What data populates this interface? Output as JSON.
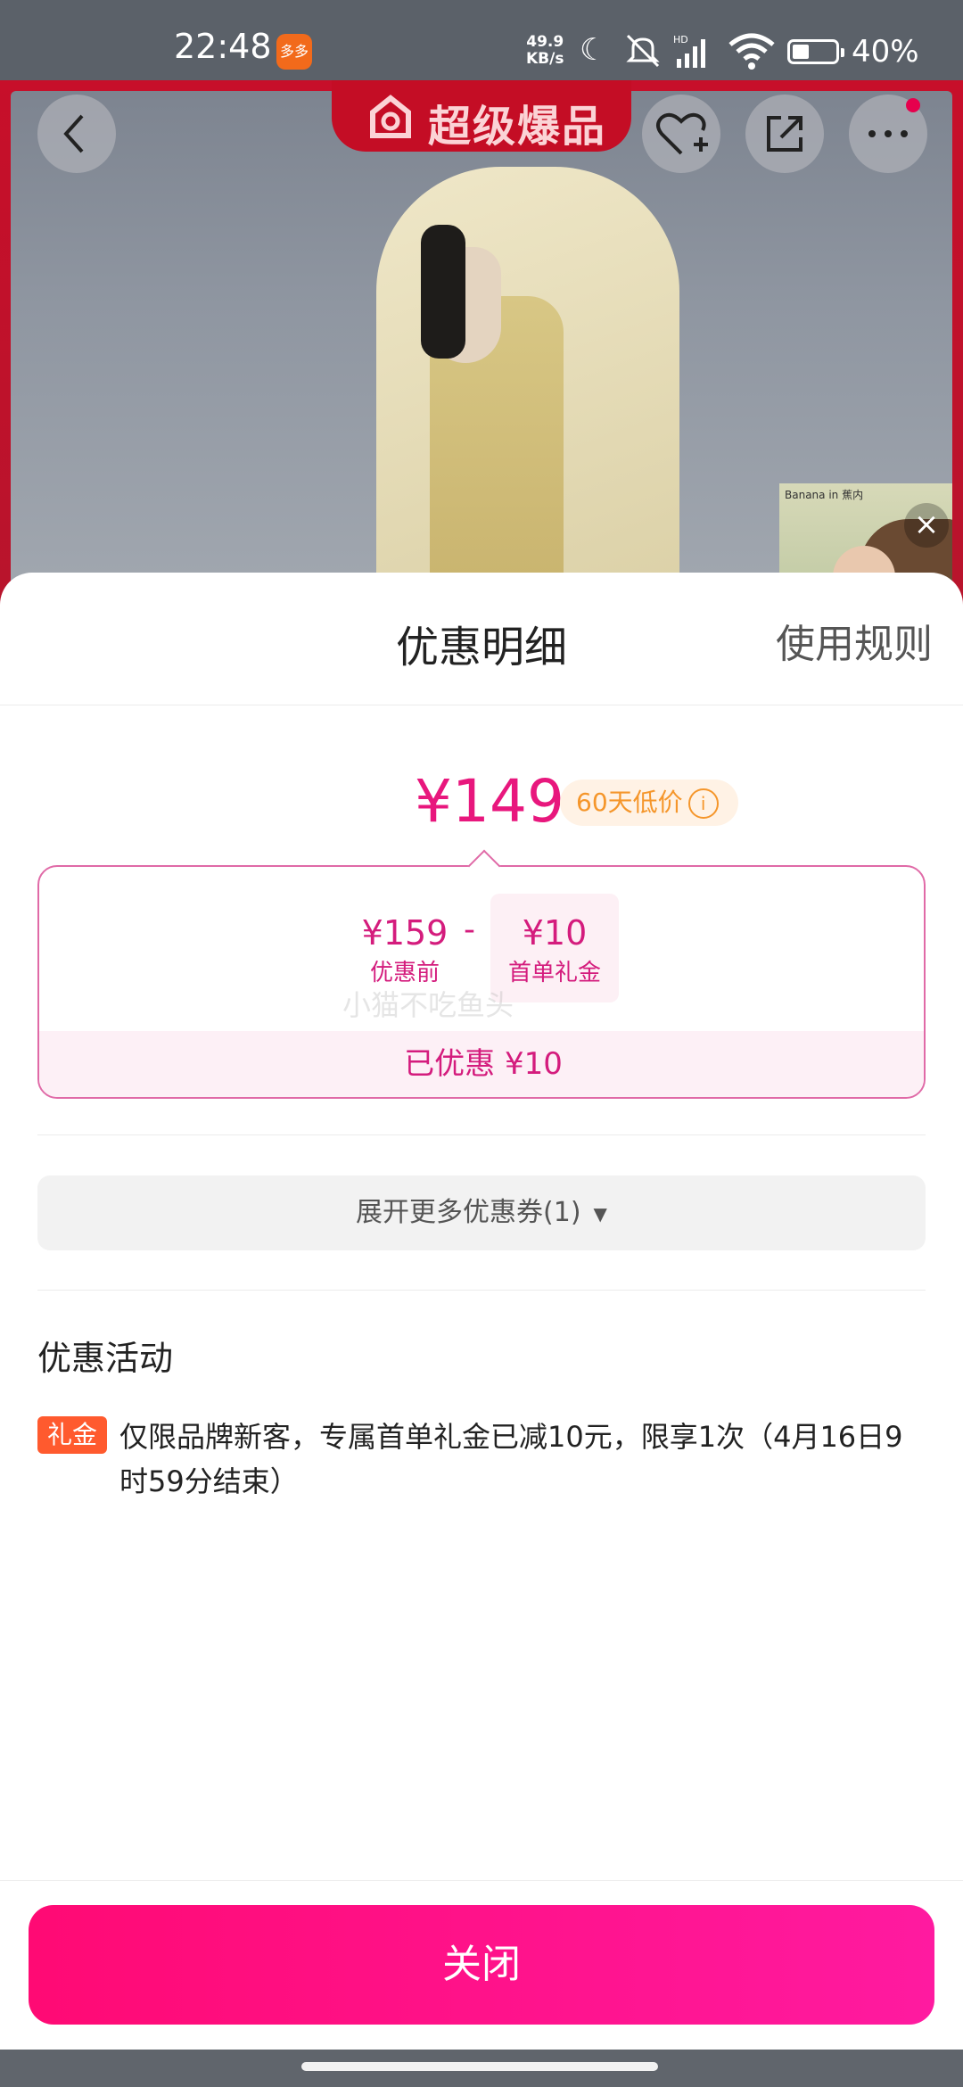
{
  "status_bar": {
    "time": "22:48",
    "app_icon_label": "多多",
    "net_speed_value": "49.9",
    "net_speed_unit": "KB/s",
    "battery_text": "40%"
  },
  "hero": {
    "brand_label": "超级爆品",
    "mini_video_label": "Banana in 蕉内"
  },
  "sheet": {
    "title": "优惠明细",
    "rules_link": "使用规则",
    "final_price": "¥149",
    "low_price_badge": "60天低价",
    "breakdown": {
      "original_amount": "¥159",
      "original_label": "优惠前",
      "minus_sign": "-",
      "gift_amount": "¥10",
      "gift_label": "首单礼金",
      "saved_text": "已优惠 ¥10"
    },
    "watermark": "小猫不吃鱼头",
    "expand_button": "展开更多优惠券(1)",
    "activity_title": "优惠活动",
    "activity": {
      "tag": "礼金",
      "description": "仅限品牌新客，专属首单礼金已减10元，限享1次（4月16日9时59分结束）"
    },
    "close_button": "关闭"
  },
  "colors": {
    "accent_pink": "#e8177d",
    "badge_orange": "#f5962b",
    "tag_red": "#ff5a2e",
    "close_gradient_start": "#ff0a74"
  }
}
